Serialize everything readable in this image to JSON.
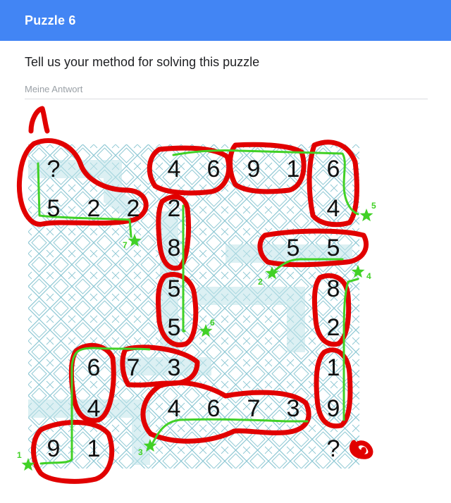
{
  "header": {
    "title": "Puzzle 6"
  },
  "question": {
    "text": "Tell us your method for solving this puzzle",
    "placeholder": "Meine Antwort"
  },
  "colors": {
    "header_bg": "#4285f4",
    "grid_line": "#8cc7d3",
    "grid_fill": "#d7eef3",
    "circle_stroke": "#e10000",
    "path_stroke": "#41d126",
    "star": "#41d126"
  },
  "puzzle": {
    "cells": [
      {
        "id": "r1c1",
        "text": "?"
      },
      {
        "id": "r1c4",
        "text": "4"
      },
      {
        "id": "r1c5",
        "text": "6"
      },
      {
        "id": "r1c6",
        "text": "9"
      },
      {
        "id": "r1c7",
        "text": "1"
      },
      {
        "id": "r1c8",
        "text": "6"
      },
      {
        "id": "r2c1",
        "text": "5"
      },
      {
        "id": "r2c2",
        "text": "2"
      },
      {
        "id": "r2c3",
        "text": "2"
      },
      {
        "id": "r2c4",
        "text": "2"
      },
      {
        "id": "r2c8",
        "text": "4"
      },
      {
        "id": "r3c4",
        "text": "8"
      },
      {
        "id": "r3c7",
        "text": "5"
      },
      {
        "id": "r3c8",
        "text": "5"
      },
      {
        "id": "r4c4",
        "text": "5"
      },
      {
        "id": "r4c8",
        "text": "8"
      },
      {
        "id": "r5c4",
        "text": "5"
      },
      {
        "id": "r5c8",
        "text": "2"
      },
      {
        "id": "r6c2",
        "text": "6"
      },
      {
        "id": "r6c3",
        "text": "7"
      },
      {
        "id": "r6c4",
        "text": "3"
      },
      {
        "id": "r6c8",
        "text": "1"
      },
      {
        "id": "r7c2",
        "text": "4"
      },
      {
        "id": "r7c4",
        "text": "4"
      },
      {
        "id": "r7c5",
        "text": "6"
      },
      {
        "id": "r7c6",
        "text": "7"
      },
      {
        "id": "r7c7",
        "text": "3"
      },
      {
        "id": "r7c8",
        "text": "9"
      },
      {
        "id": "r8c1",
        "text": "9"
      },
      {
        "id": "r8c2",
        "text": "1"
      },
      {
        "id": "r8c8",
        "text": "?"
      }
    ],
    "stars": [
      {
        "id": "star-1",
        "label": "1"
      },
      {
        "id": "star-2",
        "label": "2"
      },
      {
        "id": "star-3",
        "label": "3"
      },
      {
        "id": "star-4",
        "label": "4"
      },
      {
        "id": "star-5",
        "label": "5"
      },
      {
        "id": "star-6",
        "label": "6"
      },
      {
        "id": "star-7",
        "label": "7"
      }
    ]
  }
}
